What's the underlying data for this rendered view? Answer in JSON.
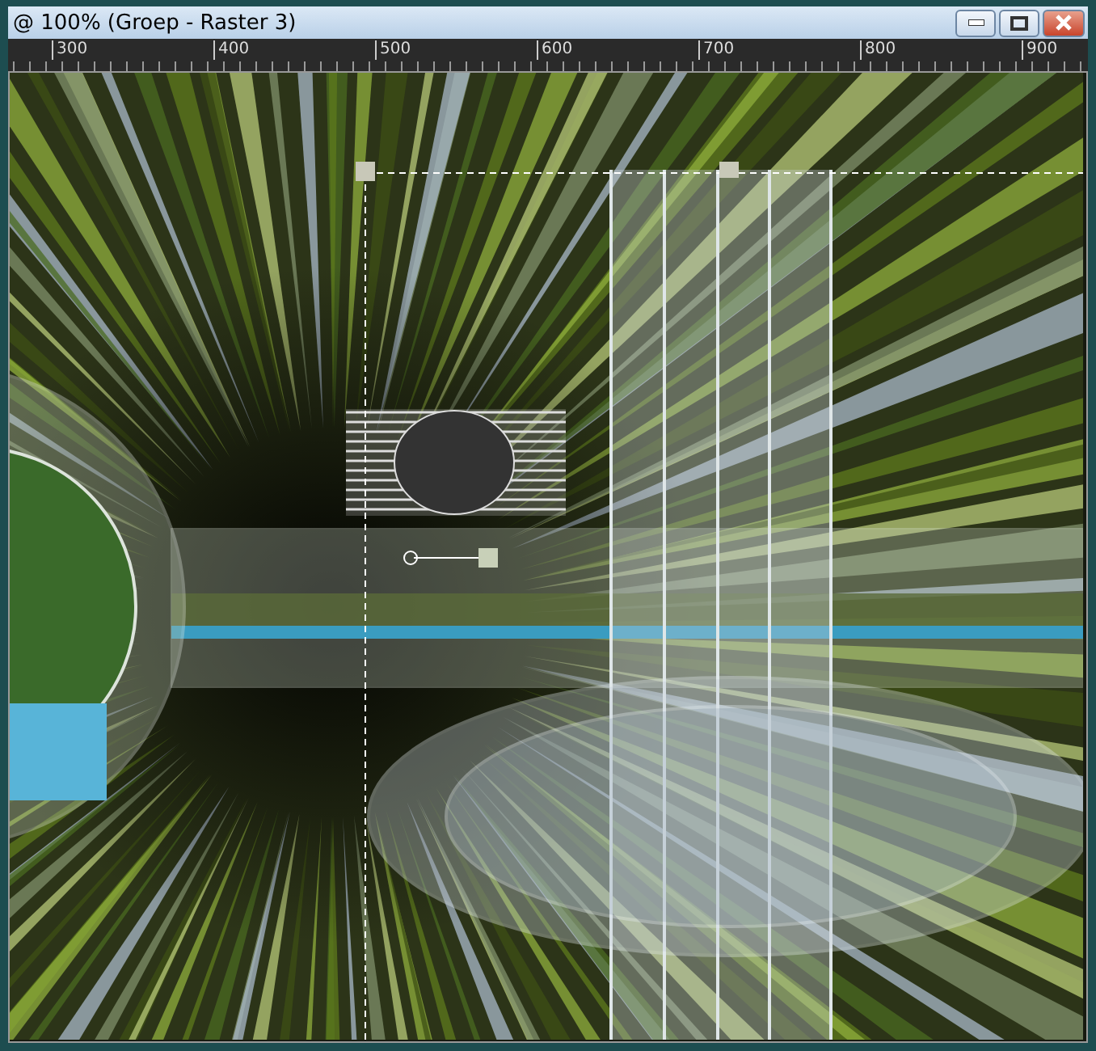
{
  "window": {
    "title": "@ 100% (Groep - Raster 3)"
  },
  "ruler": {
    "labels": [
      "300",
      "400",
      "500",
      "600",
      "700",
      "800",
      "900"
    ]
  }
}
